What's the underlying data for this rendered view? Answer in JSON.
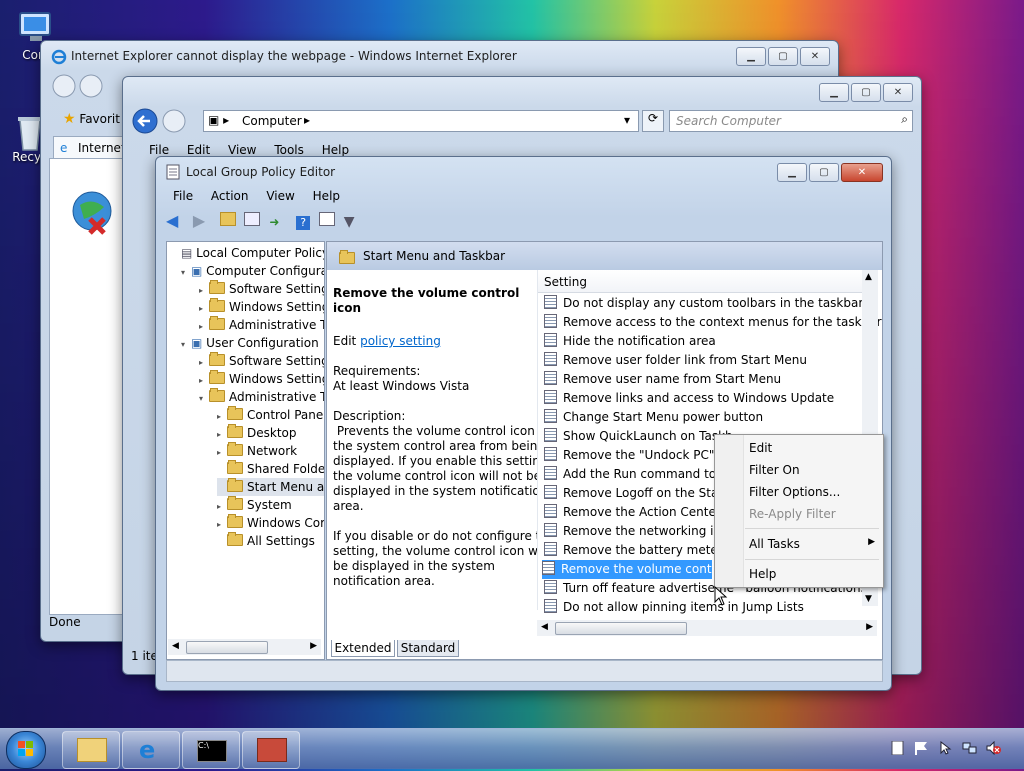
{
  "desktop": {
    "icons": [
      {
        "label": "Com"
      },
      {
        "label": "Recyc"
      }
    ]
  },
  "ie_window": {
    "title": "Internet Explorer cannot display the webpage - Windows Internet Explorer",
    "favorites_label": "Favorit",
    "tab_label": "Internet",
    "status_text": "Done"
  },
  "explorer_window": {
    "address": "Computer",
    "search_placeholder": "Search Computer",
    "menu": [
      "File",
      "Edit",
      "View",
      "Tools",
      "Help"
    ],
    "status_text": "1 ite"
  },
  "gpedit": {
    "title": "Local Group Policy Editor",
    "menu": [
      "File",
      "Action",
      "View",
      "Help"
    ],
    "tree": [
      {
        "label": "Local Computer Policy",
        "level": 0
      },
      {
        "label": "Computer Configura",
        "level": 1
      },
      {
        "label": "Software Settings",
        "level": 2
      },
      {
        "label": "Windows Setting",
        "level": 2
      },
      {
        "label": "Administrative Te",
        "level": 2
      },
      {
        "label": "User Configuration",
        "level": 1
      },
      {
        "label": "Software Settings",
        "level": 2
      },
      {
        "label": "Windows Setting",
        "level": 2
      },
      {
        "label": "Administrative Te",
        "level": 2
      },
      {
        "label": "Control Panel",
        "level": 3
      },
      {
        "label": "Desktop",
        "level": 3
      },
      {
        "label": "Network",
        "level": 3
      },
      {
        "label": "Shared Folder",
        "level": 3
      },
      {
        "label": "Start Menu ar",
        "level": 3
      },
      {
        "label": "System",
        "level": 3
      },
      {
        "label": "Windows Cor",
        "level": 3
      },
      {
        "label": "All Settings",
        "level": 3
      }
    ],
    "content_header": "Start Menu and Taskbar",
    "description": {
      "title": "Remove the volume control icon",
      "edit_prefix": "Edit",
      "edit_link": "policy setting",
      "requirements_label": "Requirements:",
      "requirements_value": "At least Windows Vista",
      "description_label": "Description:",
      "paragraph1_lines": [
        " Prevents the volume control icon in",
        "the system control area from being",
        "displayed. If you enable this setting,",
        "the volume control icon will not be",
        "displayed in the system notification",
        "area."
      ],
      "paragraph2_lines": [
        "If you disable or do not configure this",
        "setting, the volume control icon will",
        "be displayed in the system",
        "notification area."
      ]
    },
    "settings_column": "Setting",
    "settings": [
      "Do not display any custom toolbars in the taskbar",
      "Remove access to the context menus for the taskbar",
      "Hide the notification area",
      "Remove user folder link from Start Menu",
      "Remove user name from Start Menu",
      "Remove links and access to Windows Update",
      "Change Start Menu power button",
      "Show QuickLaunch on Taskb",
      "Remove the \"Undock PC\" bu",
      "Add the Run command to th",
      "Remove Logoff on the Start M",
      "Remove the Action Center ic",
      "Remove the networking icon",
      "Remove the battery meter",
      "Remove the volume control i",
      "Turn off feature advertiseme   balloon notifications",
      "Do not allow pinning items in Jump Lists"
    ],
    "selected_index": 14,
    "tabs": [
      "Extended",
      "Standard"
    ]
  },
  "context_menu": {
    "items": [
      "Edit",
      "Filter On",
      "Filter Options...",
      "Re-Apply Filter",
      "All Tasks",
      "Help"
    ],
    "disabled": [
      "Re-Apply Filter"
    ]
  }
}
